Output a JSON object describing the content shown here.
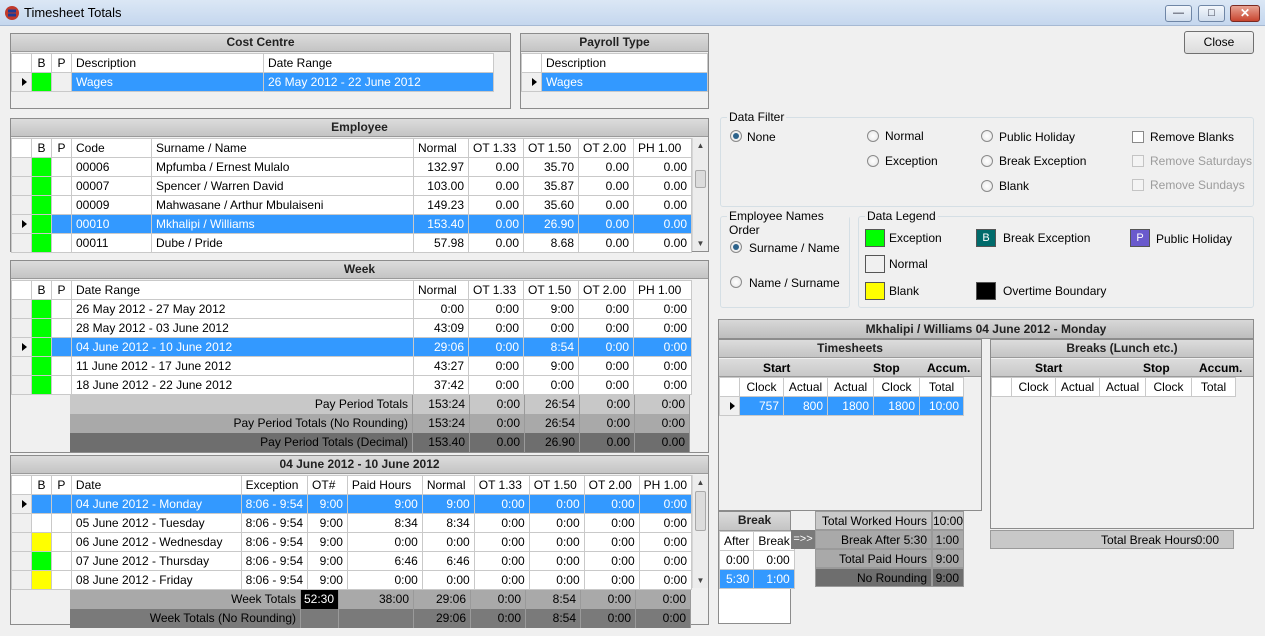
{
  "window": {
    "title": "Timesheet Totals"
  },
  "close_label": "Close",
  "cost_centre": {
    "title": "Cost Centre",
    "headers": [
      "B",
      "P",
      "Description",
      "Date Range"
    ],
    "rows": [
      {
        "description": "Wages",
        "date_range": "26 May 2012 - 22 June 2012"
      }
    ]
  },
  "payroll_type": {
    "title": "Payroll Type",
    "headers": [
      "Description"
    ],
    "rows": [
      {
        "description": "Wages"
      }
    ]
  },
  "employee": {
    "title": "Employee",
    "headers": [
      "B",
      "P",
      "Code",
      "Surname / Name",
      "Normal",
      "OT 1.33",
      "OT 1.50",
      "OT 2.00",
      "PH 1.00"
    ],
    "rows": [
      {
        "code": "00006",
        "name": "Mpfumba / Ernest Mulalo",
        "normal": "132.97",
        "ot133": "0.00",
        "ot150": "35.70",
        "ot200": "0.00",
        "ph": "0.00",
        "flag": "#00ff00"
      },
      {
        "code": "00007",
        "name": "Spencer / Warren David",
        "normal": "103.00",
        "ot133": "0.00",
        "ot150": "35.87",
        "ot200": "0.00",
        "ph": "0.00",
        "flag": "#00ff00"
      },
      {
        "code": "00009",
        "name": "Mahwasane / Arthur Mbulaiseni",
        "normal": "149.23",
        "ot133": "0.00",
        "ot150": "35.60",
        "ot200": "0.00",
        "ph": "0.00",
        "flag": "#00ff00"
      },
      {
        "code": "00010",
        "name": "Mkhalipi / Williams",
        "normal": "153.40",
        "ot133": "0.00",
        "ot150": "26.90",
        "ot200": "0.00",
        "ph": "0.00",
        "flag": "#00ff00"
      },
      {
        "code": "00011",
        "name": "Dube / Pride",
        "normal": "57.98",
        "ot133": "0.00",
        "ot150": "8.68",
        "ot200": "0.00",
        "ph": "0.00",
        "flag": "#00ff00"
      }
    ]
  },
  "week": {
    "title": "Week",
    "headers": [
      "B",
      "P",
      "Date Range",
      "Normal",
      "OT 1.33",
      "OT 1.50",
      "OT 2.00",
      "PH 1.00"
    ],
    "rows": [
      {
        "range": "26 May 2012 - 27 May 2012",
        "normal": "0:00",
        "ot133": "0:00",
        "ot150": "9:00",
        "ot200": "0:00",
        "ph": "0:00"
      },
      {
        "range": "28 May 2012 - 03 June 2012",
        "normal": "43:09",
        "ot133": "0:00",
        "ot150": "0:00",
        "ot200": "0:00",
        "ph": "0:00"
      },
      {
        "range": "04 June 2012 - 10 June 2012",
        "normal": "29:06",
        "ot133": "0:00",
        "ot150": "8:54",
        "ot200": "0:00",
        "ph": "0:00"
      },
      {
        "range": "11 June 2012 - 17 June 2012",
        "normal": "43:27",
        "ot133": "0:00",
        "ot150": "9:00",
        "ot200": "0:00",
        "ph": "0:00"
      },
      {
        "range": "18 June 2012 - 22 June 2012",
        "normal": "37:42",
        "ot133": "0:00",
        "ot150": "0:00",
        "ot200": "0:00",
        "ph": "0:00"
      }
    ],
    "totals": [
      {
        "label": "Pay Period Totals",
        "normal": "153:24",
        "ot133": "0:00",
        "ot150": "26:54",
        "ot200": "0:00",
        "ph": "0:00"
      },
      {
        "label": "Pay Period Totals (No Rounding)",
        "normal": "153:24",
        "ot133": "0:00",
        "ot150": "26:54",
        "ot200": "0:00",
        "ph": "0:00"
      },
      {
        "label": "Pay Period Totals (Decimal)",
        "normal": "153.40",
        "ot133": "0.00",
        "ot150": "26.90",
        "ot200": "0.00",
        "ph": "0.00"
      }
    ]
  },
  "days": {
    "title": "04 June 2012 - 10 June 2012",
    "headers": [
      "B",
      "P",
      "Date",
      "Exception",
      "OT#",
      "Paid Hours",
      "Normal",
      "OT 1.33",
      "OT 1.50",
      "OT 2.00",
      "PH 1.00"
    ],
    "rows": [
      {
        "date": "04 June 2012 - Monday",
        "exception": "8:06 - 9:54",
        "otn": "9:00",
        "paid": "9:00",
        "normal": "9:00",
        "ot133": "0:00",
        "ot150": "0:00",
        "ot200": "0:00",
        "ph": "0:00",
        "flag": ""
      },
      {
        "date": "05 June 2012 - Tuesday",
        "exception": "8:06 - 9:54",
        "otn": "9:00",
        "paid": "8:34",
        "normal": "8:34",
        "ot133": "0:00",
        "ot150": "0:00",
        "ot200": "0:00",
        "ph": "0:00",
        "flag": ""
      },
      {
        "date": "06 June 2012 - Wednesday",
        "exception": "8:06 - 9:54",
        "otn": "9:00",
        "paid": "0:00",
        "normal": "0:00",
        "ot133": "0:00",
        "ot150": "0:00",
        "ot200": "0:00",
        "ph": "0:00",
        "flag": "#ffff00"
      },
      {
        "date": "07 June 2012 - Thursday",
        "exception": "8:06 - 9:54",
        "otn": "9:00",
        "paid": "6:46",
        "normal": "6:46",
        "ot133": "0:00",
        "ot150": "0:00",
        "ot200": "0:00",
        "ph": "0:00",
        "flag": "#00ff00"
      },
      {
        "date": "08 June 2012 - Friday",
        "exception": "8:06 - 9:54",
        "otn": "9:00",
        "paid": "0:00",
        "normal": "0:00",
        "ot133": "0:00",
        "ot150": "0:00",
        "ot200": "0:00",
        "ph": "0:00",
        "flag": "#ffff00"
      }
    ],
    "totals": [
      {
        "label": "Week Totals",
        "otn": "52:30",
        "paid": "38:00",
        "normal": "29:06",
        "ot133": "0:00",
        "ot150": "8:54",
        "ot200": "0:00",
        "ph": "0:00"
      },
      {
        "label": "Week Totals (No Rounding)",
        "otn": "",
        "paid": "",
        "normal": "29:06",
        "ot133": "0:00",
        "ot150": "8:54",
        "ot200": "0:00",
        "ph": "0:00"
      }
    ]
  },
  "data_filter": {
    "title": "Data Filter",
    "radios": [
      "None",
      "Normal",
      "Public Holiday",
      "Exception",
      "Break Exception",
      "Blank"
    ],
    "selected": "None",
    "checks": [
      "Remove Blanks",
      "Remove Saturdays",
      "Remove Sundays"
    ]
  },
  "names_order": {
    "title": "Employee Names Order",
    "options": [
      "Surname / Name",
      "Name / Surname"
    ],
    "selected": "Surname / Name"
  },
  "legend": {
    "title": "Data Legend",
    "items": [
      {
        "label": "Exception",
        "color": "#00ff00",
        "glyph": ""
      },
      {
        "label": "Break Exception",
        "color": "#006b6b",
        "glyph": "B"
      },
      {
        "label": "Public Holiday",
        "color": "#6a5acd",
        "glyph": "P"
      },
      {
        "label": "Normal",
        "color": "#f0f0f0",
        "glyph": ""
      },
      {
        "label": "Blank",
        "color": "#ffff00",
        "glyph": ""
      },
      {
        "label": "Overtime Boundary",
        "color": "#000000",
        "glyph": ""
      }
    ]
  },
  "detail": {
    "title": "Mkhalipi / Williams   04 June 2012 - Monday",
    "timesheets": {
      "title": "Timesheets",
      "groups": [
        "Start",
        "Stop",
        "Accum."
      ],
      "headers": [
        "Clock",
        "Actual",
        "Actual",
        "Clock",
        "Total"
      ],
      "rows": [
        {
          "start_clock": "757",
          "start_actual": "800",
          "stop_actual": "1800",
          "stop_clock": "1800",
          "total": "10:00"
        }
      ]
    },
    "breaks": {
      "title": "Breaks (Lunch etc.)",
      "groups": [
        "Start",
        "Stop",
        "Accum."
      ],
      "headers": [
        "Clock",
        "Actual",
        "Actual",
        "Clock",
        "Total"
      ]
    },
    "break_range": {
      "title": "Break Range",
      "headers": [
        "After",
        "Break"
      ],
      "rows": [
        {
          "after": "0:00",
          "break": "0:00"
        },
        {
          "after": "5:30",
          "break": "1:00"
        }
      ],
      "arrow": "=>>"
    },
    "summary": [
      {
        "label": "Total Worked Hours",
        "value": "10:00"
      },
      {
        "label": "Break After 5:30",
        "value": "1:00"
      },
      {
        "label": "Total Paid Hours",
        "value": "9:00"
      },
      {
        "label": "No Rounding",
        "value": "9:00"
      }
    ],
    "total_break": {
      "label": "Total Break Hours",
      "value": "0:00"
    }
  }
}
